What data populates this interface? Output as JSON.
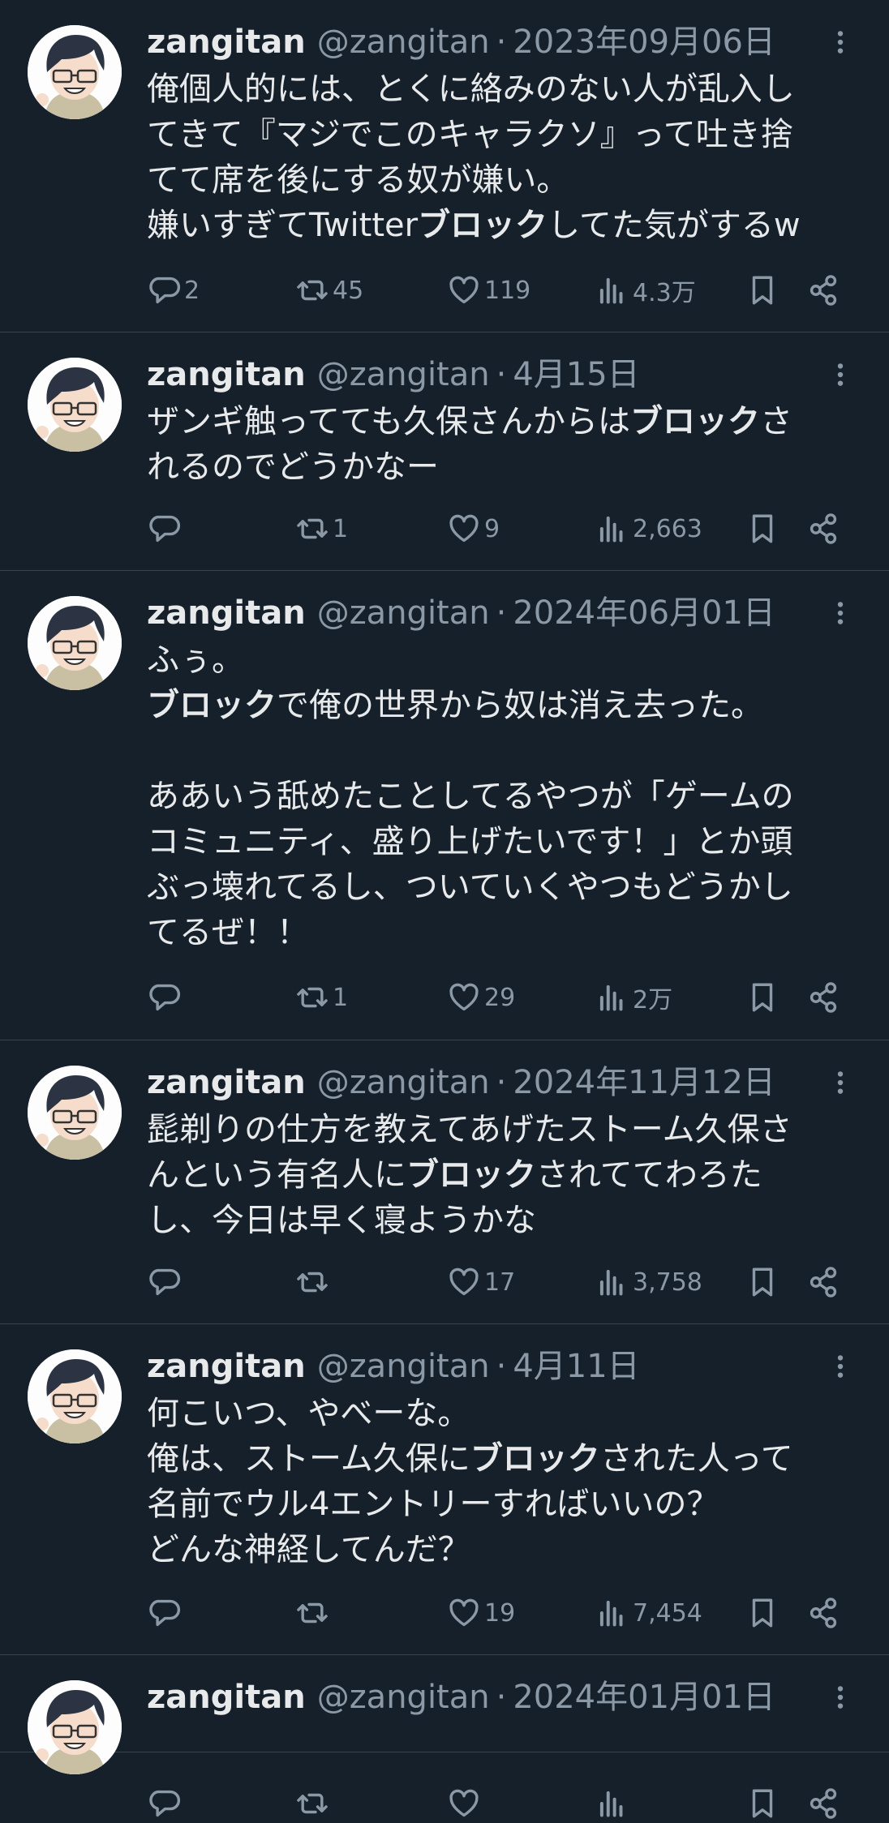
{
  "colors": {
    "background": "#15202b",
    "text": "#e7e9ea",
    "muted": "#8b98a5",
    "divider": "#38444d"
  },
  "icons": {
    "reply": "speech-bubble-icon",
    "retweet": "retweet-arrows-icon",
    "like": "heart-icon",
    "views": "bar-chart-icon",
    "bookmark": "bookmark-icon",
    "share": "share-icon",
    "more": "more-vertical-icon"
  },
  "tweets": [
    {
      "name": "zangitan",
      "handle": "@zangitan",
      "sep": "·",
      "date": "2023年09月06日",
      "lines": [
        [
          "俺個人的には、とくに絡みのない人が乱入し"
        ],
        [
          "てきて『マジでこのキャラクソ』って吐き捨"
        ],
        [
          "てて席を後にする奴が嫌い。"
        ],
        [
          "嫌いすぎてTwitter",
          "ブロック",
          "してた気がするw"
        ]
      ],
      "replies": "2",
      "retweets": "45",
      "likes": "119",
      "views": "4.3万"
    },
    {
      "name": "zangitan",
      "handle": "@zangitan",
      "sep": "·",
      "date": "4月15日",
      "lines": [
        [
          "ザンギ触ってても久保さんからは",
          "ブロック",
          "さ"
        ],
        [
          "れるのでどうかなー"
        ]
      ],
      "replies": "",
      "retweets": "1",
      "likes": "9",
      "views": "2,663"
    },
    {
      "name": "zangitan",
      "handle": "@zangitan",
      "sep": "·",
      "date": "2024年06月01日",
      "lines": [
        [
          "ふぅ。"
        ],
        [
          "",
          "ブロック",
          "で俺の世界から奴は消え去った。"
        ],
        [
          ""
        ],
        [
          "ああいう舐めたことしてるやつが「ゲームの"
        ],
        [
          "コミュニティ、盛り上げたいです！」とか頭"
        ],
        [
          "ぶっ壊れてるし、ついていくやつもどうかし"
        ],
        [
          "てるぜ！！"
        ]
      ],
      "replies": "",
      "retweets": "1",
      "likes": "29",
      "views": "2万"
    },
    {
      "name": "zangitan",
      "handle": "@zangitan",
      "sep": "·",
      "date": "2024年11月12日",
      "lines": [
        [
          "髭剃りの仕方を教えてあげたストーム久保さ"
        ],
        [
          "んという有名人に",
          "ブロック",
          "されててわろた"
        ],
        [
          "し、今日は早く寝ようかな"
        ]
      ],
      "replies": "",
      "retweets": "",
      "likes": "17",
      "views": "3,758"
    },
    {
      "name": "zangitan",
      "handle": "@zangitan",
      "sep": "·",
      "date": "4月11日",
      "lines": [
        [
          "何こいつ、やべーな。"
        ],
        [
          "俺は、ストーム久保に",
          "ブロック",
          "された人って"
        ],
        [
          "名前でウル4エントリーすればいいの？"
        ],
        [
          "どんな神経してんだ？"
        ]
      ],
      "replies": "",
      "retweets": "",
      "likes": "19",
      "views": "7,454"
    },
    {
      "name": "zangitan",
      "handle": "@zangitan",
      "sep": "·",
      "date": "2024年01月01日",
      "lines": [],
      "replies": "",
      "retweets": "",
      "likes": "",
      "views": ""
    }
  ]
}
